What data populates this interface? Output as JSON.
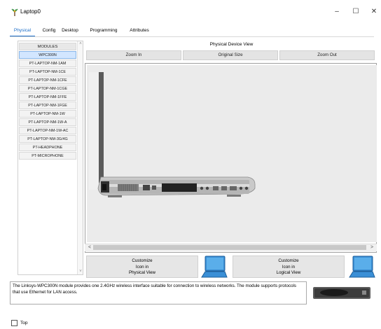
{
  "window": {
    "title": "Laptop0",
    "controls": {
      "minimize": "–",
      "maximize": "☐",
      "close": "✕"
    }
  },
  "tabs": [
    {
      "label": "Physical",
      "active": true
    },
    {
      "label": "Config",
      "active": false
    },
    {
      "label": "Desktop",
      "active": false
    },
    {
      "label": "Programming",
      "active": false
    },
    {
      "label": "Attributes",
      "active": false
    }
  ],
  "modules": {
    "header": "MODULES",
    "selected": "WPC300N",
    "items": [
      "WPC300N",
      "PT-LAPTOP-NM-1AM",
      "PT-LAPTOP-NM-1CE",
      "PT-LAPTOP-NM-1CFE",
      "PT-LAPTOP-NM-1CGE",
      "PT-LAPTOP-NM-1FFE",
      "PT-LAPTOP-NM-1FGE",
      "PT-LAPTOP-NM-1W",
      "PT-LAPTOP-NM-1W-A",
      "PT-LAPTOP-NM-1W-AC",
      "PT-LAPTOP-NM-3G/4G",
      "PT-HEADPHONE",
      "PT-MICROPHONE"
    ]
  },
  "device_view": {
    "title": "Physical Device View",
    "zoom_in": "Zoom In",
    "original_size": "Original Size",
    "zoom_out": "Zoom Out",
    "scroll_left": "<",
    "scroll_right": ">"
  },
  "customize": {
    "physical": [
      "Customize",
      "Icon in",
      "Physical View"
    ],
    "logical": [
      "Customize",
      "Icon in",
      "Logical View"
    ]
  },
  "description": "The Linksys-WPC300N module provides one 2.4GHz wireless interface suitable for connection to wireless networks. The module supports protocols that use Ethernet for LAN access.",
  "footer": {
    "top_label": "Top",
    "top_checked": false
  },
  "colors": {
    "accent": "#1c6ec8",
    "laptop_icon": "#3a8fd6"
  }
}
